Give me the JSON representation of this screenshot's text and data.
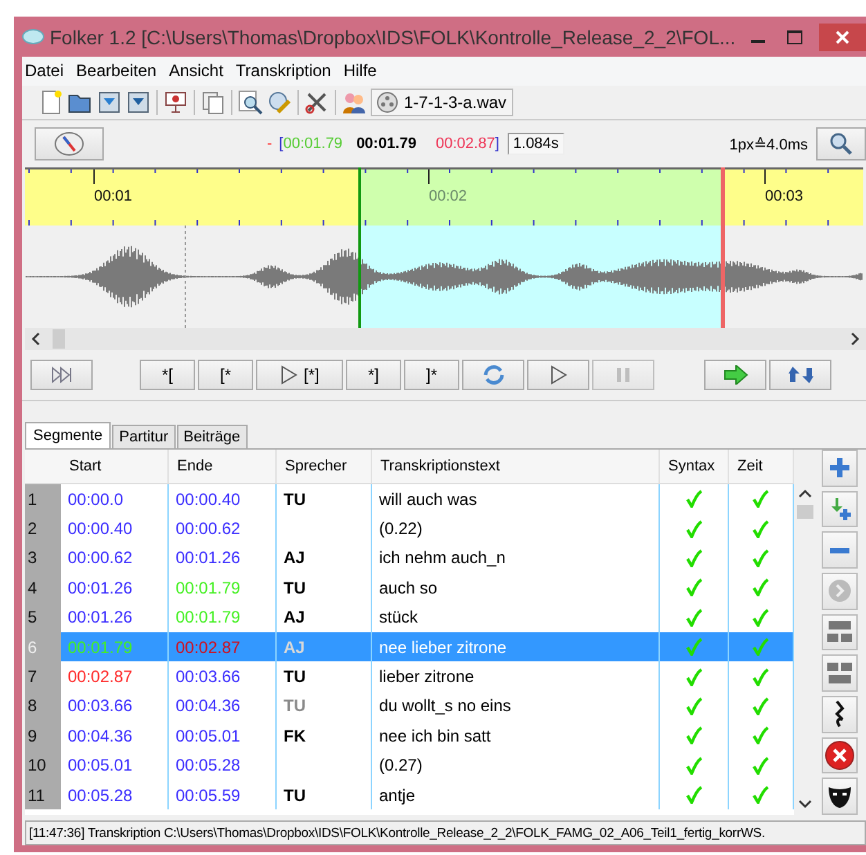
{
  "window": {
    "title": "Folker 1.2 [C:\\Users\\Thomas\\Dropbox\\IDS\\FOLK\\Kontrolle_Release_2_2\\FOL..."
  },
  "menu": [
    "Datei",
    "Bearbeiten",
    "Ansicht",
    "Transkription",
    "Hilfe"
  ],
  "toolbar": {
    "file": "1-7-1-3-a.wav"
  },
  "timebar": {
    "dash": "-",
    "open": "[",
    "sel_start": "00:01.79",
    "current": "00:01.79",
    "sel_end": "00:02.87",
    "close": "]",
    "duration": "1.084s",
    "zoom": "1px≙4.0ms"
  },
  "ruler": [
    "00:01",
    "00:02",
    "00:03"
  ],
  "transport": [
    "*[",
    "[*",
    "[*]",
    "*]",
    "]*"
  ],
  "tabs": [
    {
      "label": "Segmente",
      "selected": true
    },
    {
      "label": "Partitur",
      "selected": false
    },
    {
      "label": "Beiträge",
      "selected": false
    }
  ],
  "table": {
    "columns": [
      "Start",
      "Ende",
      "Sprecher",
      "Transkriptionstext",
      "Syntax",
      "Zeit"
    ],
    "rows": [
      {
        "num": "1",
        "start": {
          "text": "00:00.0",
          "color": "#3a2cff"
        },
        "end": {
          "text": "00:00.40",
          "color": "#3a2cff"
        },
        "speaker": {
          "text": "TU",
          "dimmed": false
        },
        "text": "will auch was",
        "syntax_ok": true,
        "time_ok": true,
        "selected": false
      },
      {
        "num": "2",
        "start": {
          "text": "00:00.40",
          "color": "#3a2cff"
        },
        "end": {
          "text": "00:00.62",
          "color": "#3a2cff"
        },
        "text": "(0.22)",
        "syntax_ok": true,
        "time_ok": true,
        "selected": false
      },
      {
        "num": "3",
        "start": {
          "text": "00:00.62",
          "color": "#3a2cff"
        },
        "end": {
          "text": "00:01.26",
          "color": "#3a2cff"
        },
        "speaker": {
          "text": "AJ",
          "dimmed": false
        },
        "text": "ich nehm auch_n",
        "syntax_ok": true,
        "time_ok": true,
        "selected": false
      },
      {
        "num": "4",
        "start": {
          "text": "00:01.26",
          "color": "#3a2cff"
        },
        "end": {
          "text": "00:01.79",
          "color": "#44f022"
        },
        "speaker": {
          "text": "TU",
          "dimmed": false
        },
        "text": "auch so",
        "syntax_ok": true,
        "time_ok": true,
        "selected": false
      },
      {
        "num": "5",
        "start": {
          "text": "00:01.26",
          "color": "#3a2cff"
        },
        "end": {
          "text": "00:01.79",
          "color": "#44f022"
        },
        "speaker": {
          "text": "AJ",
          "dimmed": false
        },
        "text": "stück",
        "syntax_ok": true,
        "time_ok": true,
        "selected": false
      },
      {
        "num": "6",
        "start": {
          "text": "00:01.79",
          "color": "#44f022"
        },
        "end": {
          "text": "00:02.87",
          "color": "#d0101e"
        },
        "speaker": {
          "text": "AJ",
          "dimmed": true
        },
        "text": "nee lieber zitrone",
        "syntax_ok": true,
        "time_ok": true,
        "selected": true
      },
      {
        "num": "7",
        "start": {
          "text": "00:02.87",
          "color": "#ff2a2a"
        },
        "end": {
          "text": "00:03.66",
          "color": "#3a2cff"
        },
        "speaker": {
          "text": "TU",
          "dimmed": false
        },
        "text": "lieber zitrone",
        "syntax_ok": true,
        "time_ok": true,
        "selected": false
      },
      {
        "num": "8",
        "start": {
          "text": "00:03.66",
          "color": "#3a2cff"
        },
        "end": {
          "text": "00:04.36",
          "color": "#3a2cff"
        },
        "speaker": {
          "text": "TU",
          "dimmed": true
        },
        "text": "du wollt_s no eins",
        "syntax_ok": true,
        "time_ok": true,
        "selected": false
      },
      {
        "num": "9",
        "start": {
          "text": "00:04.36",
          "color": "#3a2cff"
        },
        "end": {
          "text": "00:05.01",
          "color": "#3a2cff"
        },
        "speaker": {
          "text": "FK",
          "dimmed": false
        },
        "text": "nee ich bin satt",
        "syntax_ok": true,
        "time_ok": true,
        "selected": false
      },
      {
        "num": "10",
        "start": {
          "text": "00:05.01",
          "color": "#3a2cff"
        },
        "end": {
          "text": "00:05.28",
          "color": "#3a2cff"
        },
        "text": "(0.27)",
        "syntax_ok": true,
        "time_ok": true,
        "selected": false
      },
      {
        "num": "11",
        "start": {
          "text": "00:05.28",
          "color": "#3a2cff"
        },
        "end": {
          "text": "00:05.59",
          "color": "#3a2cff"
        },
        "speaker": {
          "text": "TU",
          "dimmed": false
        },
        "text": "antje",
        "syntax_ok": true,
        "time_ok": true,
        "selected": false
      }
    ]
  },
  "status_bar": "[11:47:36] Transkription C:\\Users\\Thomas\\Dropbox\\IDS\\FOLK\\Kontrolle_Release_2_2\\FOLK_FAMG_02_A06_Teil1_fertig_korrWS."
}
